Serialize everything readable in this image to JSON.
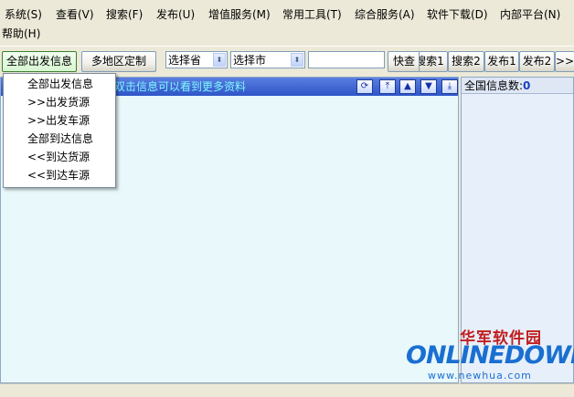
{
  "menubar": {
    "items": [
      "系统(S)",
      "查看(V)",
      "搜索(F)",
      "发布(U)",
      "增值服务(M)",
      "常用工具(T)",
      "综合服务(A)",
      "软件下载(D)",
      "内部平台(N)",
      "帮助(H)"
    ]
  },
  "toolbar": {
    "all_depart_label": "全部出发信息",
    "multi_region_label": "多地区定制",
    "province_value": "选择省",
    "city_value": "选择市",
    "quick_search_label": "快查",
    "search1_label": "搜索1",
    "search2_label": "搜索2",
    "publish1_label": "发布1",
    "publish2_label": "发布2",
    "more_label": ">>"
  },
  "left_panel": {
    "header_text": "双击信息可以看到更多资料",
    "nav_icons": [
      "refresh-icon",
      "jump-top-icon",
      "arrow-up-icon",
      "arrow-down-icon",
      "jump-bottom-icon"
    ]
  },
  "right_panel": {
    "header_label": "全国信息数:",
    "header_count": "0"
  },
  "dropdown": {
    "items": [
      "全部出发信息",
      ">>出发货源",
      ">>出发车源",
      "全部到达信息",
      "<<到达货源",
      "<<到达车源"
    ]
  },
  "watermark": {
    "cn": "华军软件园",
    "en": "ONLINEDOWN",
    "url": "www.newhua.com"
  },
  "colors": {
    "chrome": "#ece9d8",
    "list_bg": "#e8f8fb",
    "header_blue": "#2e55c8",
    "header_text": "#7ff7ff"
  }
}
